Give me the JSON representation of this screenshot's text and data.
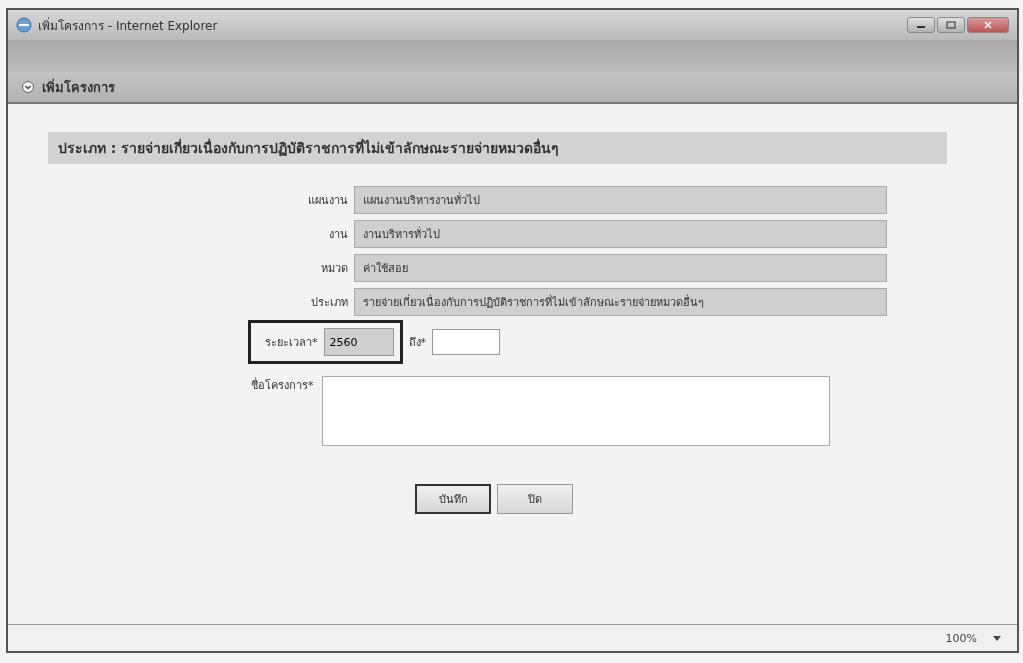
{
  "window": {
    "title": "เพิ่มโครงการ - Internet Explorer"
  },
  "panel": {
    "title": "เพิ่มโครงการ"
  },
  "section": {
    "label": "ประเภท : รายจ่ายเกี่ยวเนื่องกับการปฏิบัติราชการที่ไม่เข้าลักษณะรายจ่ายหมวดอื่นๆ"
  },
  "fields": [
    {
      "label": "แผนงาน",
      "value": "แผนงานบริหารงานทั่วไป"
    },
    {
      "label": "งาน",
      "value": "งานบริหารทั่วไป"
    },
    {
      "label": "หมวด",
      "value": "ค่าใช้สอย"
    },
    {
      "label": "ประเภท",
      "value": "รายจ่ายเกี่ยวเนื่องกับการปฏิบัติราชการที่ไม่เข้าลักษณะรายจ่ายหมวดอื่นๆ"
    }
  ],
  "period": {
    "label": "ระยะเวลา*",
    "value": "2560",
    "to_label": "ถึง*"
  },
  "project_name": {
    "label": "ชื่อโครงการ*"
  },
  "buttons": [
    {
      "label": "บันทึก",
      "focused": true
    },
    {
      "label": "ปิด",
      "focused": false
    }
  ],
  "status_bar": {
    "zoom": "100%"
  }
}
